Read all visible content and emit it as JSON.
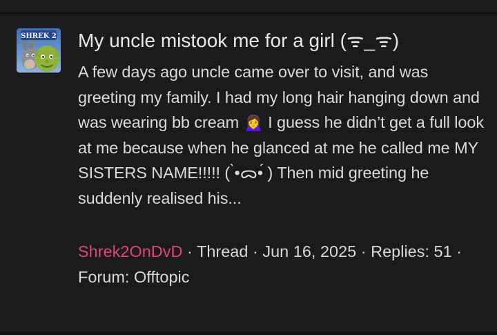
{
  "result": {
    "avatar_alt": "Shrek 2",
    "avatar_logo_text": "SHREK 2",
    "title": "My uncle mistook me for a girl (ᯤ_ᯤ)",
    "snippet": "A few days ago uncle came over to visit, and was greeting my family. I had my long hair hanging down and was wearing bb cream 🙍‍♀️ I guess he didn’t get a full look at me because when he glanced at me he called me MY SISTERS NAME!!!!! ( ̀•ᯅ•́ ) Then mid greeting he suddenly realised his...",
    "meta": {
      "author": "Shrek2OnDvD",
      "sep1": " · ",
      "type": "Thread",
      "sep2": " · ",
      "date": "Jun 16, 2025",
      "sep3": " · ",
      "replies": "Replies: 51",
      "sep4": " · ",
      "forum_prefix": "Forum: ",
      "forum": "Offtopic"
    }
  },
  "colors": {
    "background": "#1b1b1d",
    "author_link": "#e0457a",
    "text": "#dadada"
  }
}
